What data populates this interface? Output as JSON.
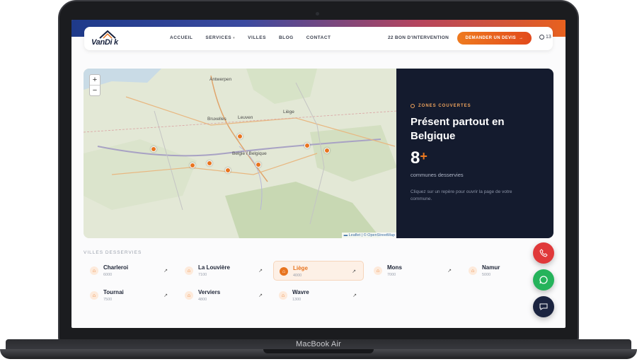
{
  "device": {
    "label": "MacBook Air"
  },
  "header": {
    "logo_text": "VanDi k",
    "nav": [
      "ACCUEIL",
      "SERVICES",
      "VILLES",
      "BLOG",
      "CONTACT"
    ],
    "bons_text": "22 BON D'INTERVENTION",
    "cta_label": "DEMANDER UN DEVIS",
    "lang_label": "13"
  },
  "map": {
    "zoom_in": "+",
    "zoom_out": "−",
    "attribution": "▬ Leaflet | © OpenStreetMap",
    "city_labels": [
      "Antwerpen",
      "Bruxelles",
      "Leuven",
      "Belgie / Belgique",
      "Liège"
    ]
  },
  "info": {
    "tag": "ZONES COUVERTES",
    "title": "Présent partout en Belgique",
    "count": "8",
    "count_suffix": "+",
    "count_label": "communes desservies",
    "note": "Cliquez sur un repère pour ouvrir la page de votre commune."
  },
  "cities": {
    "title": "VILLES DESSERVIES",
    "items": [
      {
        "name": "Charleroi",
        "code": "6000",
        "active": false
      },
      {
        "name": "La Louvière",
        "code": "7100",
        "active": false
      },
      {
        "name": "Liège",
        "code": "4000",
        "active": true
      },
      {
        "name": "Mons",
        "code": "7000",
        "active": false
      },
      {
        "name": "Namur",
        "code": "5000",
        "active": false
      },
      {
        "name": "Tournai",
        "code": "7500",
        "active": false
      },
      {
        "name": "Verviers",
        "code": "4800",
        "active": false
      },
      {
        "name": "Wavre",
        "code": "1300",
        "active": false
      }
    ]
  },
  "colors": {
    "accent": "#e8741f",
    "panel": "#141b2e",
    "phone": "#e0393a",
    "whatsapp": "#25b35b"
  }
}
